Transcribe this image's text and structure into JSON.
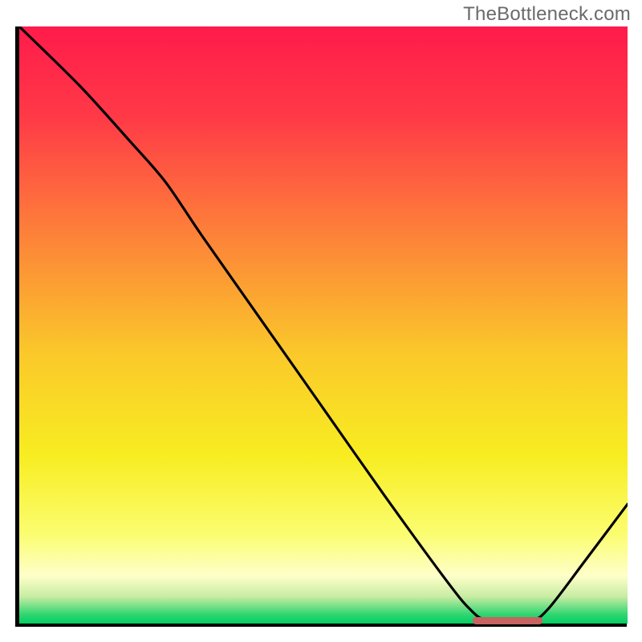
{
  "watermark": "TheBottleneck.com",
  "plot": {
    "inner_width": 758,
    "inner_height": 744
  },
  "chart_data": {
    "type": "line",
    "title": "",
    "xlabel": "",
    "ylabel": "",
    "xlim": [
      0,
      100
    ],
    "ylim": [
      0,
      100
    ],
    "gradient_stops": [
      {
        "offset": 0.0,
        "color": "#ff1b4b"
      },
      {
        "offset": 0.15,
        "color": "#ff3947"
      },
      {
        "offset": 0.35,
        "color": "#fd8239"
      },
      {
        "offset": 0.55,
        "color": "#fac92a"
      },
      {
        "offset": 0.72,
        "color": "#f8ed21"
      },
      {
        "offset": 0.85,
        "color": "#fbfd70"
      },
      {
        "offset": 0.92,
        "color": "#feffc9"
      },
      {
        "offset": 0.955,
        "color": "#c8eca3"
      },
      {
        "offset": 0.985,
        "color": "#2fd671"
      },
      {
        "offset": 1.0,
        "color": "#04ce62"
      }
    ],
    "series": [
      {
        "name": "curve",
        "points": [
          {
            "x": 0.0,
            "y": 100.0
          },
          {
            "x": 10.0,
            "y": 90.0
          },
          {
            "x": 18.0,
            "y": 81.0
          },
          {
            "x": 24.0,
            "y": 74.0
          },
          {
            "x": 30.0,
            "y": 65.0
          },
          {
            "x": 40.0,
            "y": 50.5
          },
          {
            "x": 50.0,
            "y": 36.0
          },
          {
            "x": 60.0,
            "y": 21.5
          },
          {
            "x": 70.0,
            "y": 7.5
          },
          {
            "x": 74.0,
            "y": 2.5
          },
          {
            "x": 77.0,
            "y": 0.5
          },
          {
            "x": 84.0,
            "y": 0.5
          },
          {
            "x": 87.0,
            "y": 2.5
          },
          {
            "x": 93.0,
            "y": 10.5
          },
          {
            "x": 100.0,
            "y": 20.0
          }
        ]
      }
    ],
    "optimal_marker": {
      "x_start": 74.5,
      "x_end": 86.0,
      "y": 0.3
    }
  }
}
